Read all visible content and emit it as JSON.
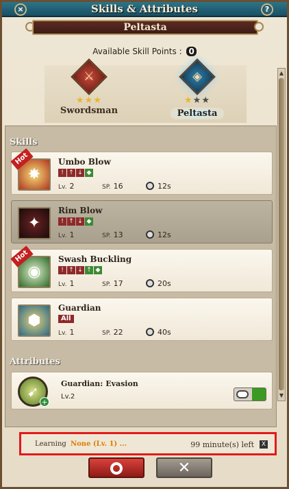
{
  "window": {
    "title": "Skills & Attributes",
    "close_icon": "close-icon",
    "help_label": "?"
  },
  "banner": {
    "class_name": "Peltasta"
  },
  "skill_points": {
    "label": "Available Skill Points :",
    "value": "0"
  },
  "class_tree": [
    {
      "name": "Swordsman",
      "stars_filled": 3,
      "stars_total": 3,
      "stars": "★★★",
      "icon": "crossed-swords-icon"
    },
    {
      "name": "Peltasta",
      "stars_filled": 1,
      "stars_total": 3,
      "stars_on": "★",
      "stars_off": "★★",
      "icon": "shield-icon"
    }
  ],
  "skills_section": {
    "title": "Skills",
    "items": [
      {
        "name": "Umbo Blow",
        "hot": "Hot",
        "level": "2",
        "sp": "16",
        "cooldown": "12s"
      },
      {
        "name": "Rim Blow",
        "hot": "",
        "level": "1",
        "sp": "13",
        "cooldown": "12s"
      },
      {
        "name": "Swash Buckling",
        "hot": "Hot",
        "level": "1",
        "sp": "17",
        "cooldown": "20s"
      },
      {
        "name": "Guardian",
        "hot": "",
        "tag": "All",
        "level": "1",
        "sp": "22",
        "cooldown": "40s"
      }
    ],
    "labels": {
      "lv": "Lv.",
      "sp": "SP."
    }
  },
  "attributes_section": {
    "title": "Attributes",
    "item": {
      "name": "Guardian: Evasion",
      "level": "Lv.2"
    }
  },
  "learning": {
    "label": "Learning",
    "value": "None (Lv. 1) ...",
    "time_left": "99 minute(s) left",
    "close": "X"
  },
  "buttons": {
    "confirm_icon": "circle-icon",
    "cancel_icon": "x-icon",
    "cancel_glyph": "✕"
  },
  "colors": {
    "title_bar": "#1a4f63",
    "banner": "#3f1c16",
    "highlight": "#e01a1a",
    "confirm": "#c9362d"
  }
}
